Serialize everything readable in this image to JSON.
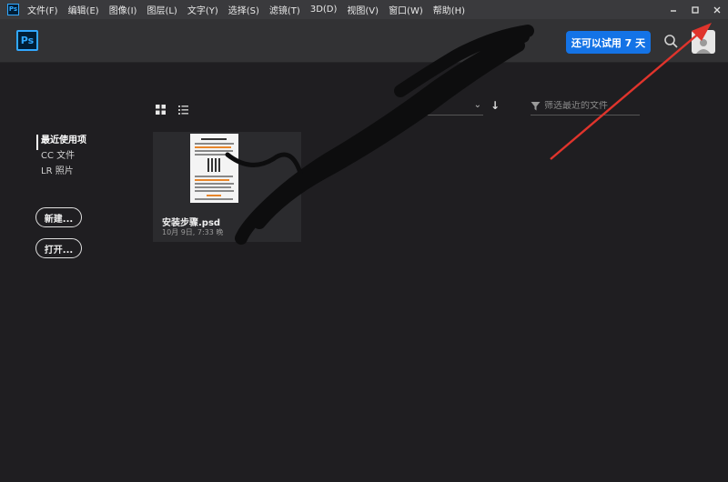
{
  "app": {
    "small_icon_text": "Ps",
    "logo_text": "Ps"
  },
  "menu": [
    {
      "label": "文件(F)"
    },
    {
      "label": "编辑(E)"
    },
    {
      "label": "图像(I)"
    },
    {
      "label": "图层(L)"
    },
    {
      "label": "文字(Y)"
    },
    {
      "label": "选择(S)"
    },
    {
      "label": "滤镜(T)"
    },
    {
      "label": "3D(D)"
    },
    {
      "label": "视图(V)"
    },
    {
      "label": "窗口(W)"
    },
    {
      "label": "帮助(H)"
    }
  ],
  "window_controls": {
    "minimize_icon": "minimize-icon",
    "maximize_icon": "maximize-icon",
    "close_icon": "close-icon"
  },
  "header": {
    "trial_label": "还可以试用 7 天",
    "trial_color": "#1473e6"
  },
  "nav": {
    "items": [
      {
        "label": "最近使用项",
        "active": true
      },
      {
        "label": "CC 文件",
        "active": false
      },
      {
        "label": "LR 照片",
        "active": false
      }
    ],
    "new_label": "新建...",
    "open_label": "打开..."
  },
  "filter": {
    "placeholder": "筛选最近的文件"
  },
  "sort": {
    "value": ""
  },
  "files": [
    {
      "name": "安装步骤.psd",
      "date": "10月 9日, 7:33 晚"
    }
  ],
  "annotation": {
    "arrow_color": "#e0342c",
    "points_to": "close-button"
  }
}
